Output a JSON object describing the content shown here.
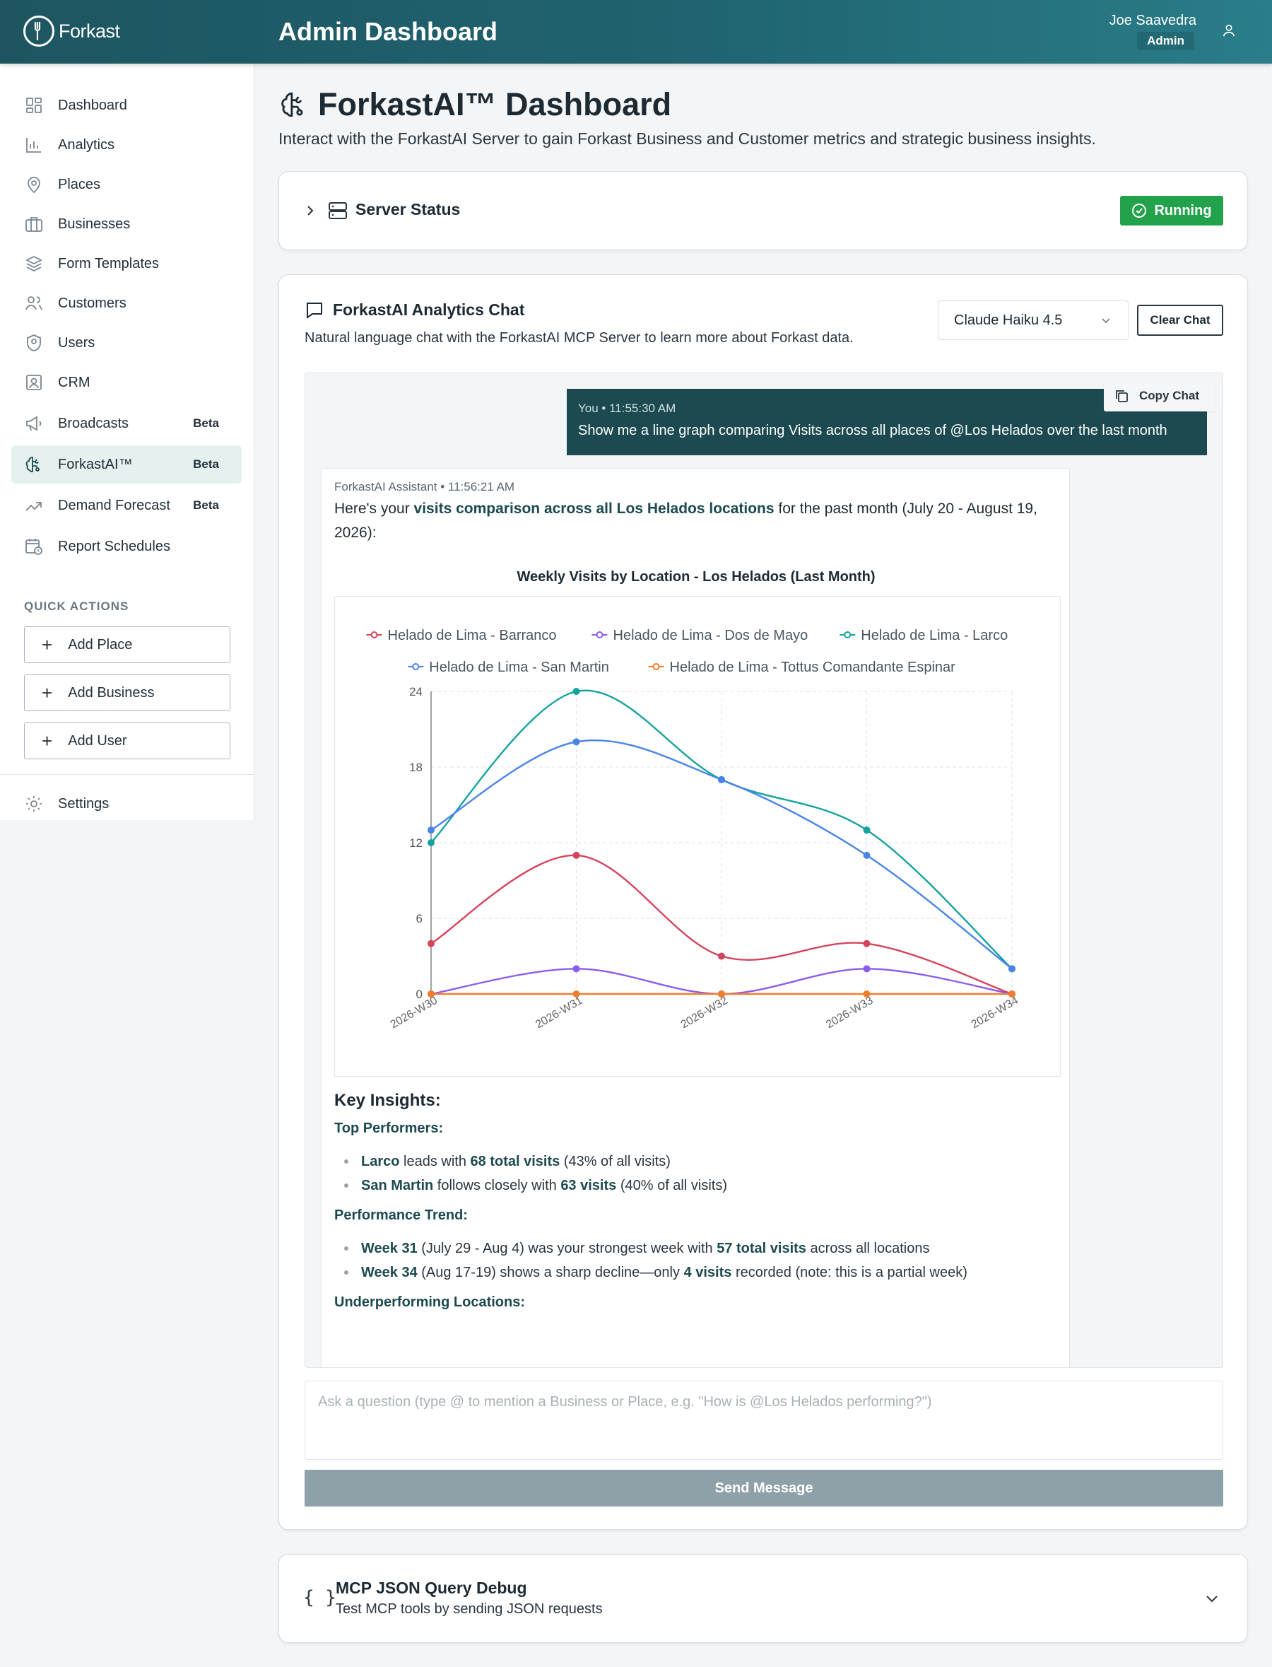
{
  "header": {
    "logo_text": "Forkast",
    "title": "Admin Dashboard",
    "user_name": "Joe Saavedra",
    "user_role": "Admin"
  },
  "sidebar": {
    "items": [
      {
        "label": "Dashboard",
        "icon": "dashboard-icon",
        "beta": ""
      },
      {
        "label": "Analytics",
        "icon": "bar-chart-icon",
        "beta": ""
      },
      {
        "label": "Places",
        "icon": "map-pin-icon",
        "beta": ""
      },
      {
        "label": "Businesses",
        "icon": "briefcase-icon",
        "beta": ""
      },
      {
        "label": "Form Templates",
        "icon": "layers-icon",
        "beta": ""
      },
      {
        "label": "Customers",
        "icon": "people-icon",
        "beta": ""
      },
      {
        "label": "Users",
        "icon": "shield-user-icon",
        "beta": ""
      },
      {
        "label": "CRM",
        "icon": "contact-card-icon",
        "beta": ""
      },
      {
        "label": "Broadcasts",
        "icon": "megaphone-icon",
        "beta": "Beta"
      },
      {
        "label": "ForkastAI™",
        "icon": "brain-icon",
        "beta": "Beta"
      },
      {
        "label": "Demand Forecast",
        "icon": "trend-up-icon",
        "beta": "Beta"
      },
      {
        "label": "Report Schedules",
        "icon": "calendar-clock-icon",
        "beta": ""
      }
    ],
    "quick_actions_label": "QUICK ACTIONS",
    "quick_actions": [
      "Add Place",
      "Add Business",
      "Add User"
    ],
    "settings_label": "Settings"
  },
  "page": {
    "title": "ForkastAI™ Dashboard",
    "subtitle": "Interact with the ForkastAI Server to gain Forkast Business and Customer metrics and strategic business insights."
  },
  "server_status": {
    "label": "Server Status",
    "status": "Running",
    "status_color": "#22a24a"
  },
  "chat": {
    "title": "ForkastAI Analytics Chat",
    "subtitle": "Natural language chat with the ForkastAI MCP Server to learn more about Forkast data.",
    "model": "Claude Haiku 4.5",
    "clear_label": "Clear Chat",
    "copy_label": "Copy Chat",
    "user_message": {
      "meta": "You • 11:55:30 AM",
      "text": "Show me a line graph comparing Visits across all places of @Los Helados over the last month"
    },
    "assistant_message": {
      "meta": "ForkastAI Assistant • 11:56:21 AM",
      "intro_a": "Here's your ",
      "intro_b": "visits comparison across all Los Helados locations",
      "intro_c": " for the past month (July 20 - August 19, 2026):",
      "insights_title": "Key Insights:",
      "top_label": "Top Performers:",
      "top": [
        {
          "b1": "Larco",
          "t1": " leads with ",
          "b2": "68 total visits",
          "t2": " (43% of all visits)"
        },
        {
          "b1": "San Martin",
          "t1": " follows closely with ",
          "b2": "63 visits",
          "t2": " (40% of all visits)"
        }
      ],
      "trend_label": "Performance Trend:",
      "trend": [
        {
          "b1": "Week 31",
          "t1": " (July 29 - Aug 4) was your strongest week with ",
          "b2": "57 total visits",
          "t2": " across all locations"
        },
        {
          "b1": "Week 34",
          "t1": " (Aug 17-19) shows a sharp decline—only ",
          "b2": "4 visits",
          "t2": " recorded (note: this is a partial week)"
        }
      ],
      "under_label": "Underperforming Locations:"
    },
    "input_placeholder": "Ask a question (type @ to mention a Business or Place, e.g. \"How is @Los Helados performing?\")",
    "send_label": "Send Message"
  },
  "debug": {
    "icon": "{ }",
    "title": "MCP JSON Query Debug",
    "subtitle": "Test MCP tools by sending JSON requests"
  },
  "chart_data": {
    "type": "line",
    "title": "Weekly Visits by Location - Los Helados (Last Month)",
    "xlabel": "",
    "ylabel": "",
    "categories": [
      "2026-W30",
      "2026-W31",
      "2026-W32",
      "2026-W33",
      "2026-W34"
    ],
    "ylim": [
      0,
      24
    ],
    "yticks": [
      0,
      6,
      12,
      18,
      24
    ],
    "grid": true,
    "legend_position": "top",
    "series": [
      {
        "name": "Helado de Lima - Barranco",
        "color": "#d6435c",
        "values": [
          4,
          11,
          3,
          4,
          0
        ]
      },
      {
        "name": "Helado de Lima - Dos de Mayo",
        "color": "#8b5cf0",
        "values": [
          0,
          2,
          0,
          2,
          0
        ]
      },
      {
        "name": "Helado de Lima - Larco",
        "color": "#14a3a0",
        "values": [
          12,
          24,
          17,
          13,
          2
        ]
      },
      {
        "name": "Helado de Lima - San Martin",
        "color": "#4a84e6",
        "values": [
          13,
          20,
          17,
          11,
          2
        ]
      },
      {
        "name": "Helado de Lima - Tottus Comandante Espinar",
        "color": "#f07d2a",
        "values": [
          0,
          0,
          0,
          0,
          0
        ]
      }
    ]
  }
}
